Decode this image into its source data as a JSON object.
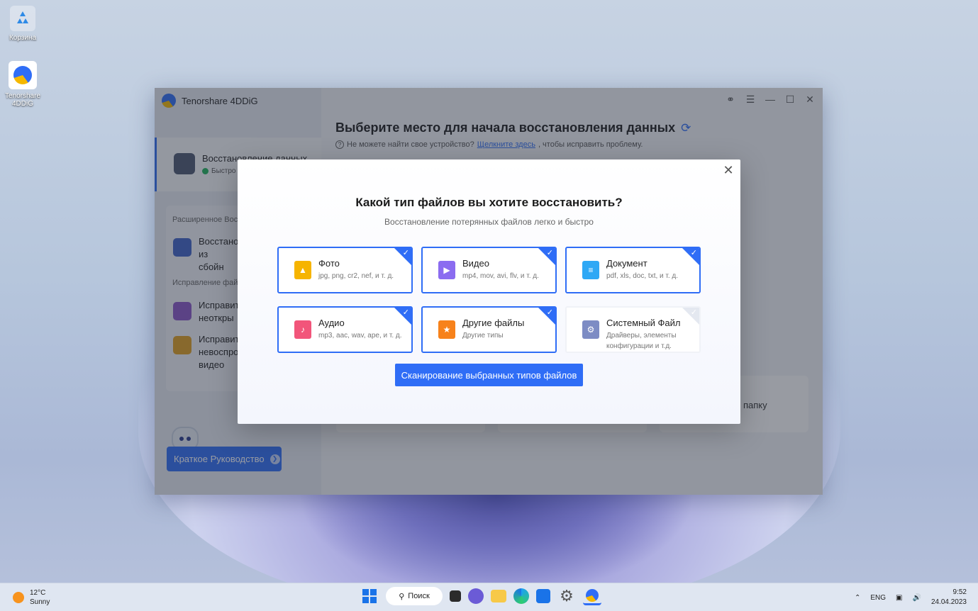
{
  "desktop": {
    "icons": [
      {
        "label": "Корзина",
        "icon": "recycle-bin-icon"
      },
      {
        "label": "Tenorshare 4DDiG",
        "icon": "tenorshare-app-icon"
      }
    ]
  },
  "app": {
    "title": "Tenorshare 4DDiG",
    "sidebar": {
      "main_item": {
        "label": "Восстановление данных",
        "status": "Быстро"
      },
      "section_advanced": "Расширенное Вос",
      "advanced_item": "Восстано из сбойн",
      "section_repair": "Исправление фай",
      "repair_items": [
        "Исправит неоткры",
        "Исправит невоспро видео"
      ],
      "guide_button": "Краткое Руководство"
    },
    "main": {
      "title": "Выберите место для начала восстановления данных",
      "hint_prefix": "Не можете найти свое устройство?",
      "hint_link": "Щелкните здесь",
      "hint_suffix": ", чтобы исправить проблему.",
      "folder_card_label": "папку"
    }
  },
  "modal": {
    "title": "Какой тип файлов вы хотите восстановить?",
    "subtitle": "Восстановление потерянных файлов легко и быстро",
    "file_types": [
      {
        "name": "Фото",
        "desc": "jpg, png, cr2, nef, и т. д.",
        "checked": true,
        "color": "#f6b400",
        "icon": "photo-icon"
      },
      {
        "name": "Видео",
        "desc": "mp4, mov, avi, flv, и т. д.",
        "checked": true,
        "color": "#8b6cf0",
        "icon": "video-icon"
      },
      {
        "name": "Документ",
        "desc": "pdf, xls, doc, txt, и т. д.",
        "checked": true,
        "color": "#2ea8f5",
        "icon": "document-icon"
      },
      {
        "name": "Аудио",
        "desc": "mp3, aac, wav, ape, и т. д.",
        "checked": true,
        "color": "#f2557a",
        "icon": "audio-icon"
      },
      {
        "name": "Другие файлы",
        "desc": "Другие типы",
        "checked": true,
        "color": "#f7821b",
        "icon": "star-file-icon"
      },
      {
        "name": "Системный Файл",
        "desc": "Драйверы, элементы конфигурации и т.д.",
        "checked": false,
        "color": "#7d8cc4",
        "icon": "gear-file-icon"
      }
    ],
    "scan_button": "Сканирование выбранных типов файлов"
  },
  "taskbar": {
    "weather_temp": "12°C",
    "weather_desc": "Sunny",
    "search_label": "Поиск",
    "lang": "ENG",
    "time": "9:52",
    "date": "24.04.2023"
  }
}
